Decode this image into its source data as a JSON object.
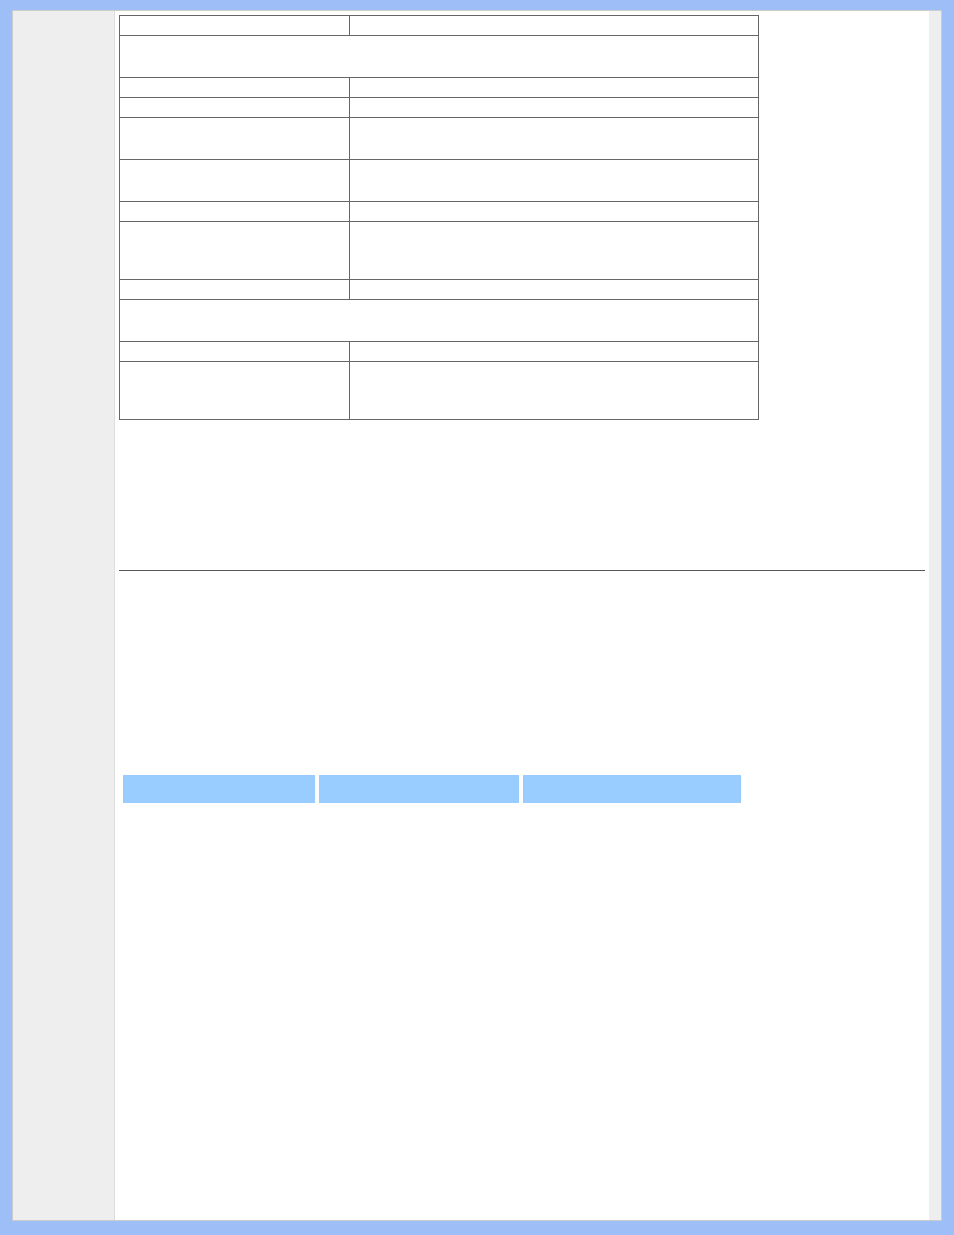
{
  "table": {
    "rows": [
      {
        "type": "pair",
        "height": "short",
        "left": "",
        "right": ""
      },
      {
        "type": "span",
        "height": "med",
        "value": ""
      },
      {
        "type": "pair",
        "height": "short",
        "left": "",
        "right": ""
      },
      {
        "type": "pair",
        "height": "short",
        "left": "",
        "right": ""
      },
      {
        "type": "pair",
        "height": "med",
        "left": "",
        "right": ""
      },
      {
        "type": "pair",
        "height": "med",
        "left": "",
        "right": ""
      },
      {
        "type": "pair",
        "height": "short",
        "left": "",
        "right": ""
      },
      {
        "type": "pair",
        "height": "tall",
        "left": "",
        "right": ""
      },
      {
        "type": "pair",
        "height": "short",
        "left": "",
        "right": ""
      },
      {
        "type": "span",
        "height": "med",
        "value": ""
      },
      {
        "type": "pair",
        "height": "short",
        "left": "",
        "right": ""
      },
      {
        "type": "pair",
        "height": "tall",
        "left": "",
        "right": ""
      }
    ]
  },
  "bluebar": {
    "segments": [
      "",
      "",
      ""
    ]
  }
}
